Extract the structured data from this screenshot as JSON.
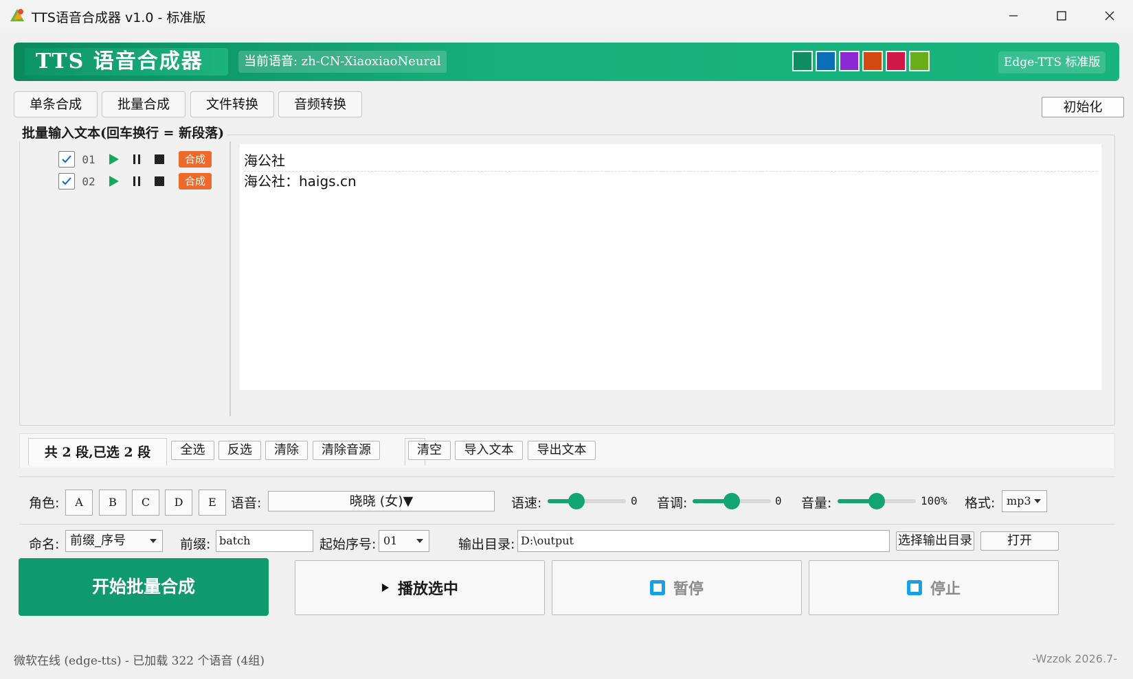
{
  "window": {
    "title": "TTS语音合成器 v1.0 - 标准版"
  },
  "header": {
    "brand": "TTS 语音合成器",
    "current_voice": "当前语音: zh-CN-XiaoxiaoNeural",
    "edition": "Edge-TTS 标准版",
    "theme_colors": [
      "#0f8c62",
      "#0a6fb4",
      "#8b2ad4",
      "#d24a12",
      "#d11848",
      "#6aad1a"
    ]
  },
  "tabs": [
    {
      "label": "单条合成",
      "active": false
    },
    {
      "label": "批量合成",
      "active": true
    },
    {
      "label": "文件转换",
      "active": false
    },
    {
      "label": "音频转换",
      "active": false
    }
  ],
  "init_button": "初始化",
  "batch": {
    "group_title": "批量输入文本(回车换行 = 新段落)",
    "segments": [
      {
        "index": "01",
        "checked": true,
        "synth_label": "合成"
      },
      {
        "index": "02",
        "checked": true,
        "synth_label": "合成"
      }
    ],
    "editor_lines": [
      "海公社",
      "海公社：haigs.cn"
    ]
  },
  "toolbar": {
    "count": "共 2 段,已选 2 段",
    "select_all": "全选",
    "invert": "反选",
    "clear": "清除",
    "clear_audio": "清除音源",
    "clear_all": "清空",
    "import_text": "导入文本",
    "export_text": "导出文本"
  },
  "params": {
    "role_label": "角色:",
    "roles": [
      "A",
      "B",
      "C",
      "D",
      "E"
    ],
    "voice_label": "语音:",
    "voice_value": "晓晓 (女)▼",
    "rate_label": "语速:",
    "rate_value": "0",
    "rate_fraction": 0.37,
    "pitch_label": "音调:",
    "pitch_value": "0",
    "pitch_fraction": 0.5,
    "volume_label": "音量:",
    "volume_value": "100%",
    "volume_fraction": 0.5,
    "format_label": "格式:",
    "format_value": "mp3"
  },
  "naming": {
    "name_label": "命名:",
    "name_value": "前缀_序号",
    "prefix_label": "前缀:",
    "prefix_value": "batch",
    "start_label": "起始序号:",
    "start_value": "01",
    "output_label": "输出目录:",
    "output_value": "D:\\output",
    "choose_dir": "选择输出目录",
    "open": "打开"
  },
  "actions": {
    "start": "开始批量合成",
    "play_selected": "播放选中",
    "pause": "暂停",
    "stop": "停止"
  },
  "status": {
    "left": "微软在线 (edge-tts) - 已加载 322 个语音 (4组)",
    "right": "-Wzzok 2026.7-"
  }
}
